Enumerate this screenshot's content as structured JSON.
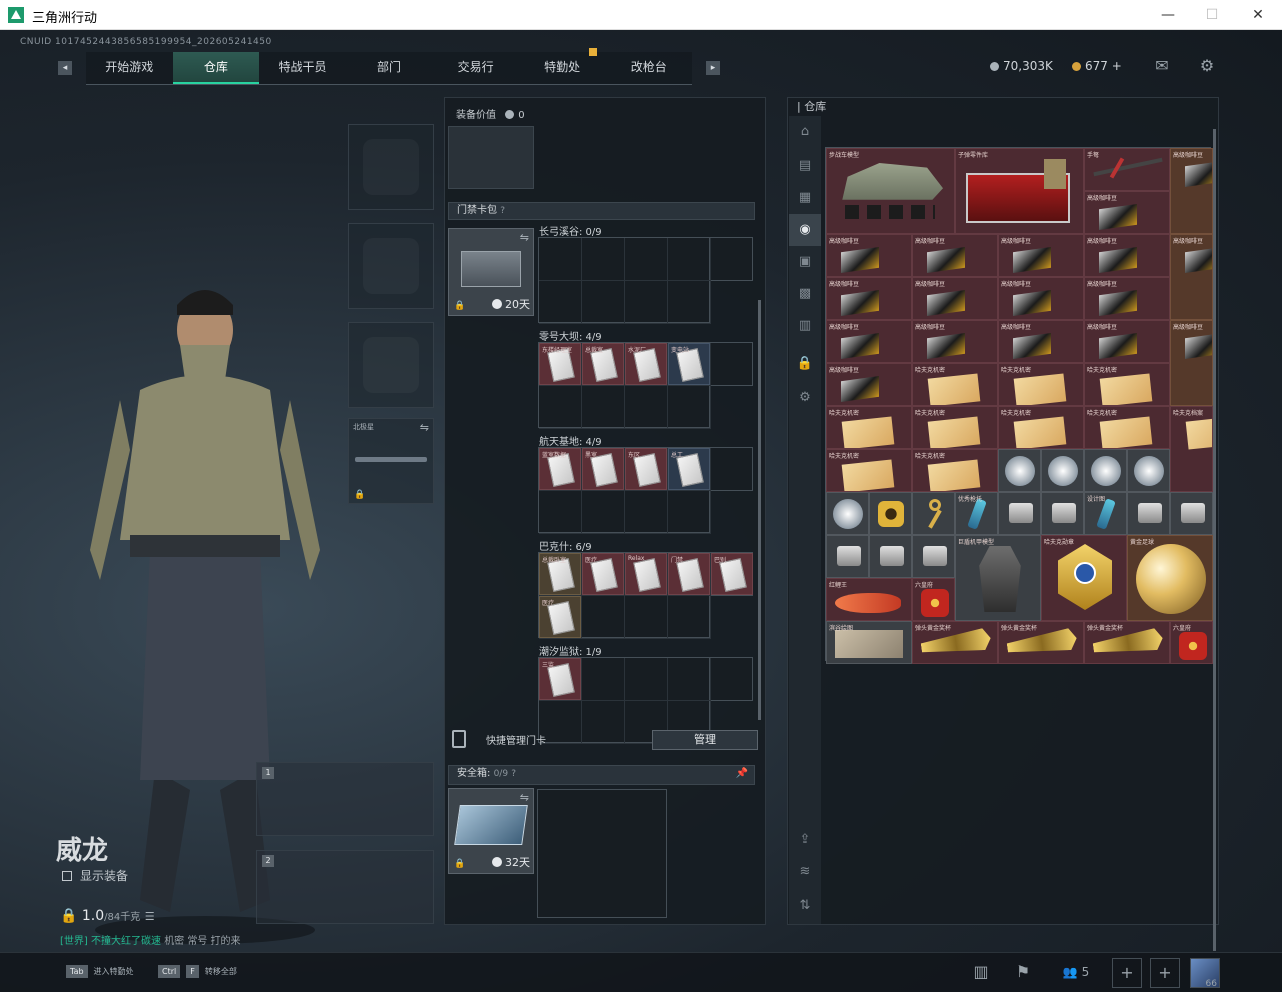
{
  "window": {
    "title": "三角洲行动",
    "min": "—",
    "max": "☐",
    "close": "✕"
  },
  "uid": "CNUID 1017452443856585199954_202605241450",
  "nav": {
    "left_edge": "◂",
    "right_edge": "▸",
    "tabs": [
      "开始游戏",
      "仓库",
      "特战干员",
      "部门",
      "交易行",
      "特勤处",
      "改枪台"
    ],
    "active": 1
  },
  "currency": {
    "coins": "70,303K",
    "tokens": "677",
    "plus": "+"
  },
  "character": {
    "name": "威龙",
    "show_gear": "显示装备",
    "weight_value": "1.0",
    "weight_max": "/84千克"
  },
  "chat": {
    "channel": "[世界]",
    "user": "不撞大红了碳速",
    "msg": "机密  常号  打的来"
  },
  "loadout": {
    "slots": [
      {
        "label": ""
      },
      {
        "label": ""
      },
      {
        "label": ""
      },
      {
        "label": "北极星"
      }
    ],
    "weapon_slots": [
      {
        "num": "1"
      },
      {
        "num": "2"
      }
    ]
  },
  "equipment": {
    "value_label": "装备价值",
    "value": "0",
    "card_bag_title": "门禁卡包",
    "help": "?",
    "card_bag_timer": "20天",
    "rows": [
      {
        "title": "长弓溪谷: 0/9",
        "cards": []
      },
      {
        "title": "零号大坝: 4/9",
        "cards": [
          "东楼经理室",
          "总裁室",
          "水泥厂",
          "变电站"
        ]
      },
      {
        "title": "航天基地: 4/9",
        "cards": [
          "蓝室数据",
          "黑室",
          "东区",
          "总工"
        ]
      },
      {
        "title": "巴克什: 6/9",
        "cards": [
          "总裁卧室",
          "医疗",
          "Relax",
          "门禁",
          "巴别",
          "医疗"
        ]
      },
      {
        "title": "潮汐监狱: 1/9",
        "cards": [
          "三监"
        ]
      }
    ],
    "quick_manage": "快捷管理门卡",
    "manage_btn": "管理",
    "safebox_title": "安全箱:",
    "safebox_count": "0/9",
    "safebox_timer": "32天"
  },
  "storage": {
    "title": "仓库",
    "items": [
      {
        "label": "步战车模型"
      },
      {
        "label": "子弹零件库"
      },
      {
        "label": "手弩"
      },
      {
        "label": "高级咖啡豆"
      },
      {
        "label": "高级咖啡豆"
      },
      {
        "label": "哈夫克机密"
      },
      {
        "label": "哈夫克档案"
      },
      {
        "label": "优秀枪托"
      },
      {
        "label": "设计图"
      },
      {
        "label": "巨盾机甲模型"
      },
      {
        "label": "哈夫克勋章"
      },
      {
        "label": "黄金足球"
      },
      {
        "label": "红鲤王"
      },
      {
        "label": "六皇府"
      },
      {
        "label": "滨谷绘图"
      },
      {
        "label": "弹头黄金奖杯"
      }
    ]
  },
  "bottom": {
    "hint1_key": "Tab",
    "hint1": "进入特勤处",
    "hint2_key": "Ctrl",
    "hint2_key2": "F",
    "hint2": "转移全部",
    "team_count": "5",
    "avatar_level": "66"
  },
  "colors": {
    "accent": "#28d3a0",
    "card_red": "#5b2f36",
    "gold": "#e8b03a"
  }
}
